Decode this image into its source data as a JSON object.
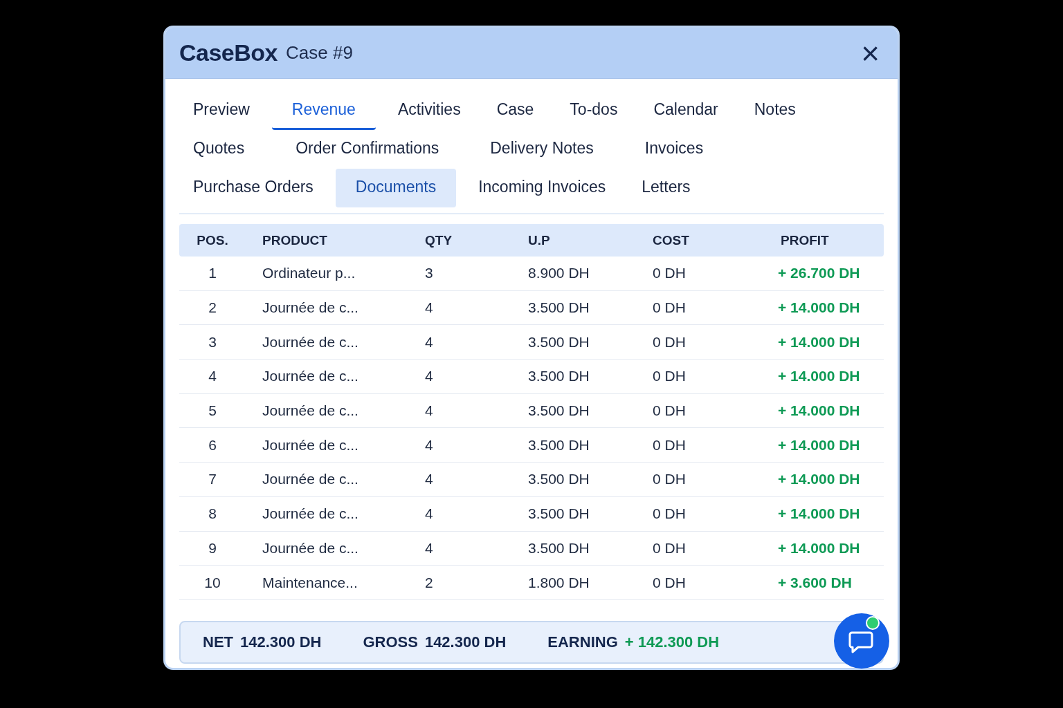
{
  "window": {
    "brand": "CaseBox",
    "title": "Case #9",
    "close": "×"
  },
  "tab_rows": [
    [
      {
        "label": "Preview",
        "selected": false,
        "highlighted": false
      },
      {
        "label": "Revenue",
        "selected": true,
        "highlighted": false
      },
      {
        "label": "Activities",
        "selected": false,
        "highlighted": false
      },
      {
        "label": "Case",
        "selected": false,
        "highlighted": false
      },
      {
        "label": "To-dos",
        "selected": false,
        "highlighted": false
      },
      {
        "label": "Calendar",
        "selected": false,
        "highlighted": false
      },
      {
        "label": "Notes",
        "selected": false,
        "highlighted": false
      }
    ],
    [
      {
        "label": "Quotes",
        "selected": false,
        "highlighted": false
      },
      {
        "label": "Order Confirmations",
        "selected": false,
        "highlighted": false
      },
      {
        "label": "Delivery Notes",
        "selected": false,
        "highlighted": false
      },
      {
        "label": "Invoices",
        "selected": false,
        "highlighted": false
      }
    ],
    [
      {
        "label": "Purchase Orders",
        "selected": false,
        "highlighted": false
      },
      {
        "label": "Documents",
        "selected": false,
        "highlighted": true
      },
      {
        "label": "Incoming Invoices",
        "selected": false,
        "highlighted": false
      },
      {
        "label": "Letters",
        "selected": false,
        "highlighted": false
      }
    ]
  ],
  "table": {
    "columns": [
      "POS.",
      "PRODUCT",
      "QTY",
      "U.P",
      "COST",
      "PROFIT"
    ],
    "rows": [
      [
        "1",
        "Ordinateur p...",
        "3",
        "8.900 DH",
        "0 DH",
        "+ 26.700 DH"
      ],
      [
        "2",
        "Journée de c...",
        "4",
        "3.500 DH",
        "0 DH",
        "+ 14.000 DH"
      ],
      [
        "3",
        "Journée de c...",
        "4",
        "3.500 DH",
        "0 DH",
        "+ 14.000 DH"
      ],
      [
        "4",
        "Journée de c...",
        "4",
        "3.500 DH",
        "0 DH",
        "+ 14.000 DH"
      ],
      [
        "5",
        "Journée de c...",
        "4",
        "3.500 DH",
        "0 DH",
        "+ 14.000 DH"
      ],
      [
        "6",
        "Journée de c...",
        "4",
        "3.500 DH",
        "0 DH",
        "+ 14.000 DH"
      ],
      [
        "7",
        "Journée de c...",
        "4",
        "3.500 DH",
        "0 DH",
        "+ 14.000 DH"
      ],
      [
        "8",
        "Journée de c...",
        "4",
        "3.500 DH",
        "0 DH",
        "+ 14.000 DH"
      ],
      [
        "9",
        "Journée de c...",
        "4",
        "3.500 DH",
        "0 DH",
        "+ 14.000 DH"
      ],
      [
        "10",
        "Maintenance...",
        "2",
        "1.800 DH",
        "0 DH",
        "+ 3.600 DH"
      ]
    ]
  },
  "totals": [
    {
      "label": "NET",
      "value": "142.300 DH",
      "kind": "plain"
    },
    {
      "label": "GROSS",
      "value": "142.300 DH",
      "kind": "plain"
    },
    {
      "label": "EARNING",
      "value": "+ 142.300 DH",
      "kind": "gain"
    }
  ],
  "chat": {
    "unread": true
  }
}
